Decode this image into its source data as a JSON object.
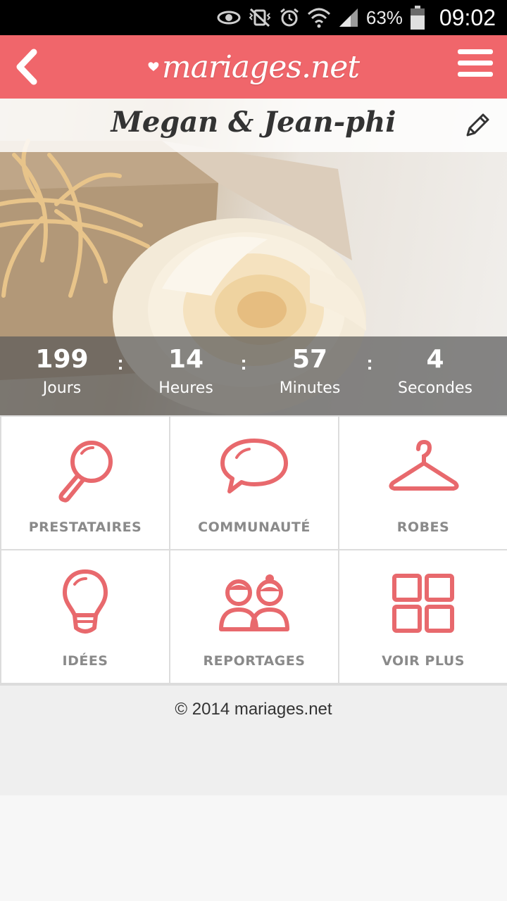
{
  "status_bar": {
    "battery_percent": "63%",
    "time": "09:02",
    "icons": [
      "eye-icon",
      "vibrate-off-icon",
      "alarm-icon",
      "wifi-icon",
      "signal-icon",
      "battery-icon"
    ]
  },
  "header": {
    "logo_text": "mariages.net",
    "back_icon": "chevron-left-icon",
    "menu_icon": "hamburger-menu-icon"
  },
  "hero": {
    "couple_name": "Megan & Jean-phi",
    "edit_icon": "pencil-icon"
  },
  "countdown": {
    "separator": ":",
    "items": [
      {
        "value": "199",
        "label": "Jours"
      },
      {
        "value": "14",
        "label": "Heures"
      },
      {
        "value": "57",
        "label": "Minutes"
      },
      {
        "value": "4",
        "label": "Secondes"
      }
    ]
  },
  "tiles": [
    {
      "label": "PRESTATAIRES",
      "icon": "magnifier-icon"
    },
    {
      "label": "COMMUNAUTÉ",
      "icon": "speech-bubble-icon"
    },
    {
      "label": "ROBES",
      "icon": "hanger-icon"
    },
    {
      "label": "IDÉES",
      "icon": "lightbulb-icon"
    },
    {
      "label": "REPORTAGES",
      "icon": "couple-icon"
    },
    {
      "label": "VOIR PLUS",
      "icon": "grid-icon"
    }
  ],
  "footer": {
    "copyright": "© 2014 mariages.net"
  },
  "colors": {
    "brand": "#f0666b",
    "icon": "#e8696d",
    "tile_label": "#8a8a8a"
  }
}
